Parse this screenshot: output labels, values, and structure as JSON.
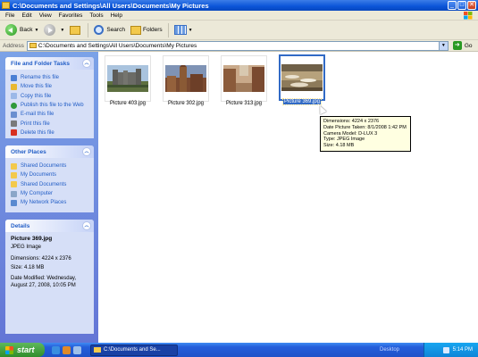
{
  "window": {
    "title": "C:\\Documents and Settings\\All Users\\Documents\\My Pictures",
    "buttons": {
      "minimize": "_",
      "maximize": "□",
      "close": "✕"
    }
  },
  "menu": [
    "File",
    "Edit",
    "View",
    "Favorites",
    "Tools",
    "Help"
  ],
  "toolbar": {
    "back_label": "Back",
    "search_label": "Search",
    "folders_label": "Folders"
  },
  "address": {
    "label": "Address",
    "value": "C:\\Documents and Settings\\All Users\\Documents\\My Pictures",
    "go_label": "Go"
  },
  "left_pane": {
    "file_tasks": {
      "title": "File and Folder Tasks",
      "items": [
        {
          "label": "Rename this file",
          "icon": "rename-icon",
          "color": "#4a7fd4"
        },
        {
          "label": "Move this file",
          "icon": "move-icon",
          "color": "#e8b832"
        },
        {
          "label": "Copy this file",
          "icon": "copy-icon",
          "color": "#9bb8e8"
        },
        {
          "label": "Publish this file to the Web",
          "icon": "globe-icon",
          "color": "#2f9a3a"
        },
        {
          "label": "E-mail this file",
          "icon": "mail-icon",
          "color": "#6a8fd0"
        },
        {
          "label": "Print this file",
          "icon": "printer-icon",
          "color": "#7a7a7a"
        },
        {
          "label": "Delete this file",
          "icon": "delete-icon",
          "color": "#d83020"
        }
      ]
    },
    "other_places": {
      "title": "Other Places",
      "items": [
        {
          "label": "Shared Documents",
          "icon": "folder-icon",
          "color": "#f3c94b"
        },
        {
          "label": "My Documents",
          "icon": "folder-icon",
          "color": "#f3c94b"
        },
        {
          "label": "Shared Documents",
          "icon": "folder-icon",
          "color": "#f3c94b"
        },
        {
          "label": "My Computer",
          "icon": "computer-icon",
          "color": "#8aa6c8"
        },
        {
          "label": "My Network Places",
          "icon": "network-icon",
          "color": "#5a8ad0"
        }
      ]
    },
    "details": {
      "title": "Details",
      "name": "Picture 369.jpg",
      "type": "JPEG Image",
      "dimensions": "Dimensions: 4224 x 2376",
      "size": "Size: 4.18 MB",
      "modified_1": "Date Modified: Wednesday,",
      "modified_2": "August 27, 2008, 10:05 PM"
    }
  },
  "thumbnails": [
    {
      "caption": "Picture 403.jpg",
      "selected": false
    },
    {
      "caption": "Picture 302.jpg",
      "selected": false
    },
    {
      "caption": "Picture 313.jpg",
      "selected": false
    },
    {
      "caption": "Picture 369.jpg",
      "selected": true
    }
  ],
  "tooltip": {
    "lines": [
      "Dimensions: 4224 x 2376",
      "Date Picture Taken: 8/1/2008 1:42 PM",
      "Camera Model: D-LUX 3",
      "Type: JPEG Image",
      "Size: 4.18 MB"
    ]
  },
  "taskbar": {
    "start_label": "start",
    "window_button": "C:\\Documents and Se...",
    "desktop_label": "Desktop",
    "clock": "5:14 PM"
  },
  "colors": {
    "title_blue": "#0a54d8",
    "pane_blue": "#6375d6",
    "link_blue": "#215dc6",
    "selection": "#316ac5"
  }
}
